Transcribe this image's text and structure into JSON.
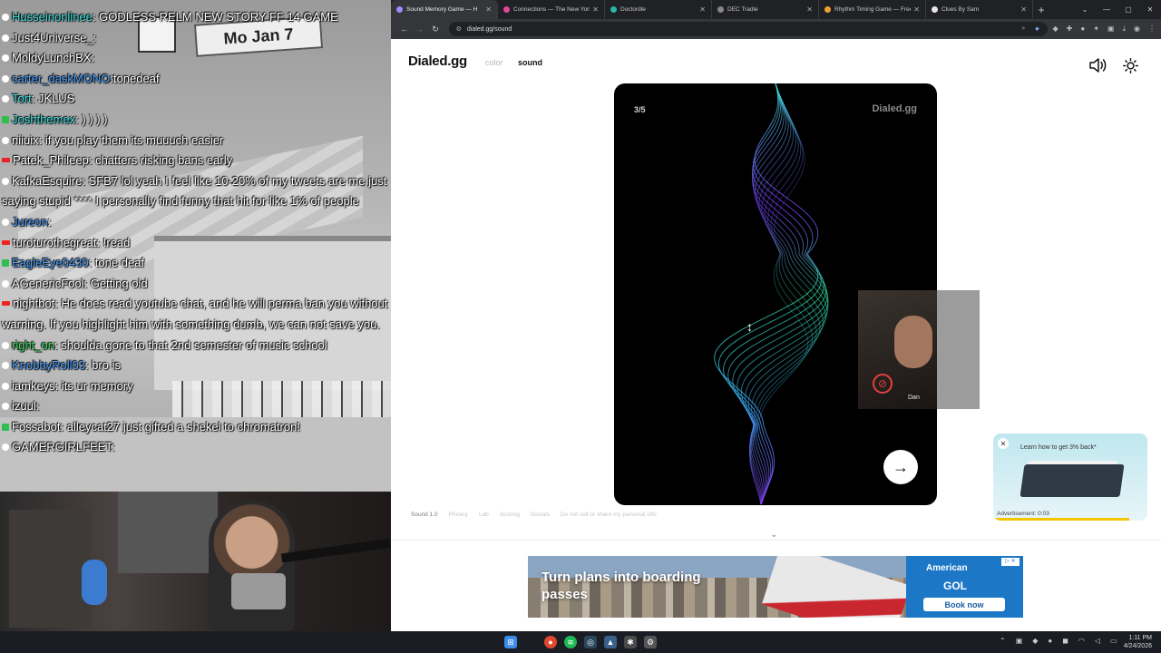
{
  "stream": {
    "game_sign": "Mo Jan 7",
    "chat": [
      {
        "user": "Husseinonlinee",
        "text": ": GODLESS RELM NEW STORY FF 14 GAME",
        "badge": "sub",
        "color": "#3fe0e0"
      },
      {
        "user": "Just4Universe_",
        "text": ":",
        "badge": "sub",
        "color": "#ffffff"
      },
      {
        "user": "MoldyLunchBX",
        "text": ":",
        "badge": "sub",
        "color": "#ffffff"
      },
      {
        "user": "carter_daskMONO",
        "text": ":tonedeaf",
        "badge": "sub",
        "color": "#4aa0ff"
      },
      {
        "user": "Tort",
        "text": ": JKLUS",
        "badge": "sub",
        "color": "#3fe0e0"
      },
      {
        "user": "Joshthemex",
        "text": ": ) ) ) )",
        "badge": "mod",
        "color": "#3fe0e0"
      },
      {
        "user": "niiuix",
        "text": ": if you play them its muuuch easier",
        "badge": "sub",
        "color": "#ffffff"
      },
      {
        "user": "Patek_Phileep",
        "text": ": chatters risking bans early",
        "badge": "bot",
        "color": "#ffffff"
      },
      {
        "user": "KafkaEsquire",
        "text": ": SFB7 lol yeah I feel like 10-20% of my tweets are me just saying stupid **** I personally find funny that hit for like 1% of people",
        "badge": "sub",
        "color": "#ffffff"
      },
      {
        "user": "Jureon",
        "text": ":",
        "badge": "sub",
        "color": "#4aa0ff"
      },
      {
        "user": "turoturothegreat",
        "text": ": !read",
        "badge": "bot",
        "color": "#ffffff"
      },
      {
        "user": "EagleEye0430",
        "text": ": tone deaf",
        "badge": "mod",
        "color": "#4aa0ff"
      },
      {
        "user": "AGenericFool",
        "text": ": Getting old",
        "badge": "sub",
        "color": "#ffffff"
      },
      {
        "user": "nightbot",
        "text": ": He does read youtube chat, and he will perma ban you without warning. If you highlight him with something dumb, we can not save you.",
        "badge": "bot",
        "color": "#ffffff"
      },
      {
        "user": "right_on",
        "text": ": shoulda gone to that 2nd semester of music school",
        "badge": "sub",
        "color": "#3fe060"
      },
      {
        "user": "KnobbyRoll03",
        "text": ": bro is",
        "badge": "sub",
        "color": "#4aa0ff"
      },
      {
        "user": "iamkeys",
        "text": ": its ur memory",
        "badge": "sub",
        "color": "#ffffff"
      },
      {
        "user": "izuul",
        "text": ":",
        "badge": "sub",
        "color": "#ffffff"
      },
      {
        "user": "Fossabot",
        "text": ": alleycat27 just gifted a shekel to chromatron!",
        "badge": "mod",
        "color": "#ffffff"
      },
      {
        "user": "GAMERGIRLFEET",
        "text": ":",
        "badge": "sub",
        "color": "#ffffff"
      }
    ]
  },
  "browser": {
    "tabs": [
      {
        "title": "Sound Memory Game — H",
        "favicon_color": "#9b8cff",
        "active": true
      },
      {
        "title": "Connections — The New York",
        "favicon_color": "#e0489a",
        "active": false
      },
      {
        "title": "Doctordle",
        "favicon_color": "#2ab5a5",
        "active": false
      },
      {
        "title": "DEC Tradle",
        "favicon_color": "#888888",
        "active": false
      },
      {
        "title": "Rhythm Timing Game — Free",
        "favicon_color": "#f0a030",
        "active": false
      },
      {
        "title": "Clues By Sam",
        "favicon_color": "#e8e8e8",
        "active": false
      }
    ],
    "url": "dialed.gg/sound",
    "newtab_label": "+"
  },
  "page": {
    "logo": "Dialed.gg",
    "nav_color": "color",
    "nav_sound": "sound",
    "round": "3/5",
    "card_brand": "Dialed.gg",
    "next_glyph": "→",
    "footer": [
      "Sound 1.0",
      "Privacy",
      "Lab",
      "Scoring",
      "Socials",
      "Do not sell or share my personal info"
    ],
    "chevron": "⌄",
    "cam_name": "Dan"
  },
  "video_ad": {
    "title": "Learn how to get 3% back*",
    "label": "Advertisement: 0:03"
  },
  "banner_ad": {
    "headline": "Turn plans into boarding passes",
    "brand": "American",
    "logo": "GOL",
    "cta": "Book now"
  },
  "taskbar": {
    "time": "1:11 PM",
    "date": "4/24/2026"
  }
}
